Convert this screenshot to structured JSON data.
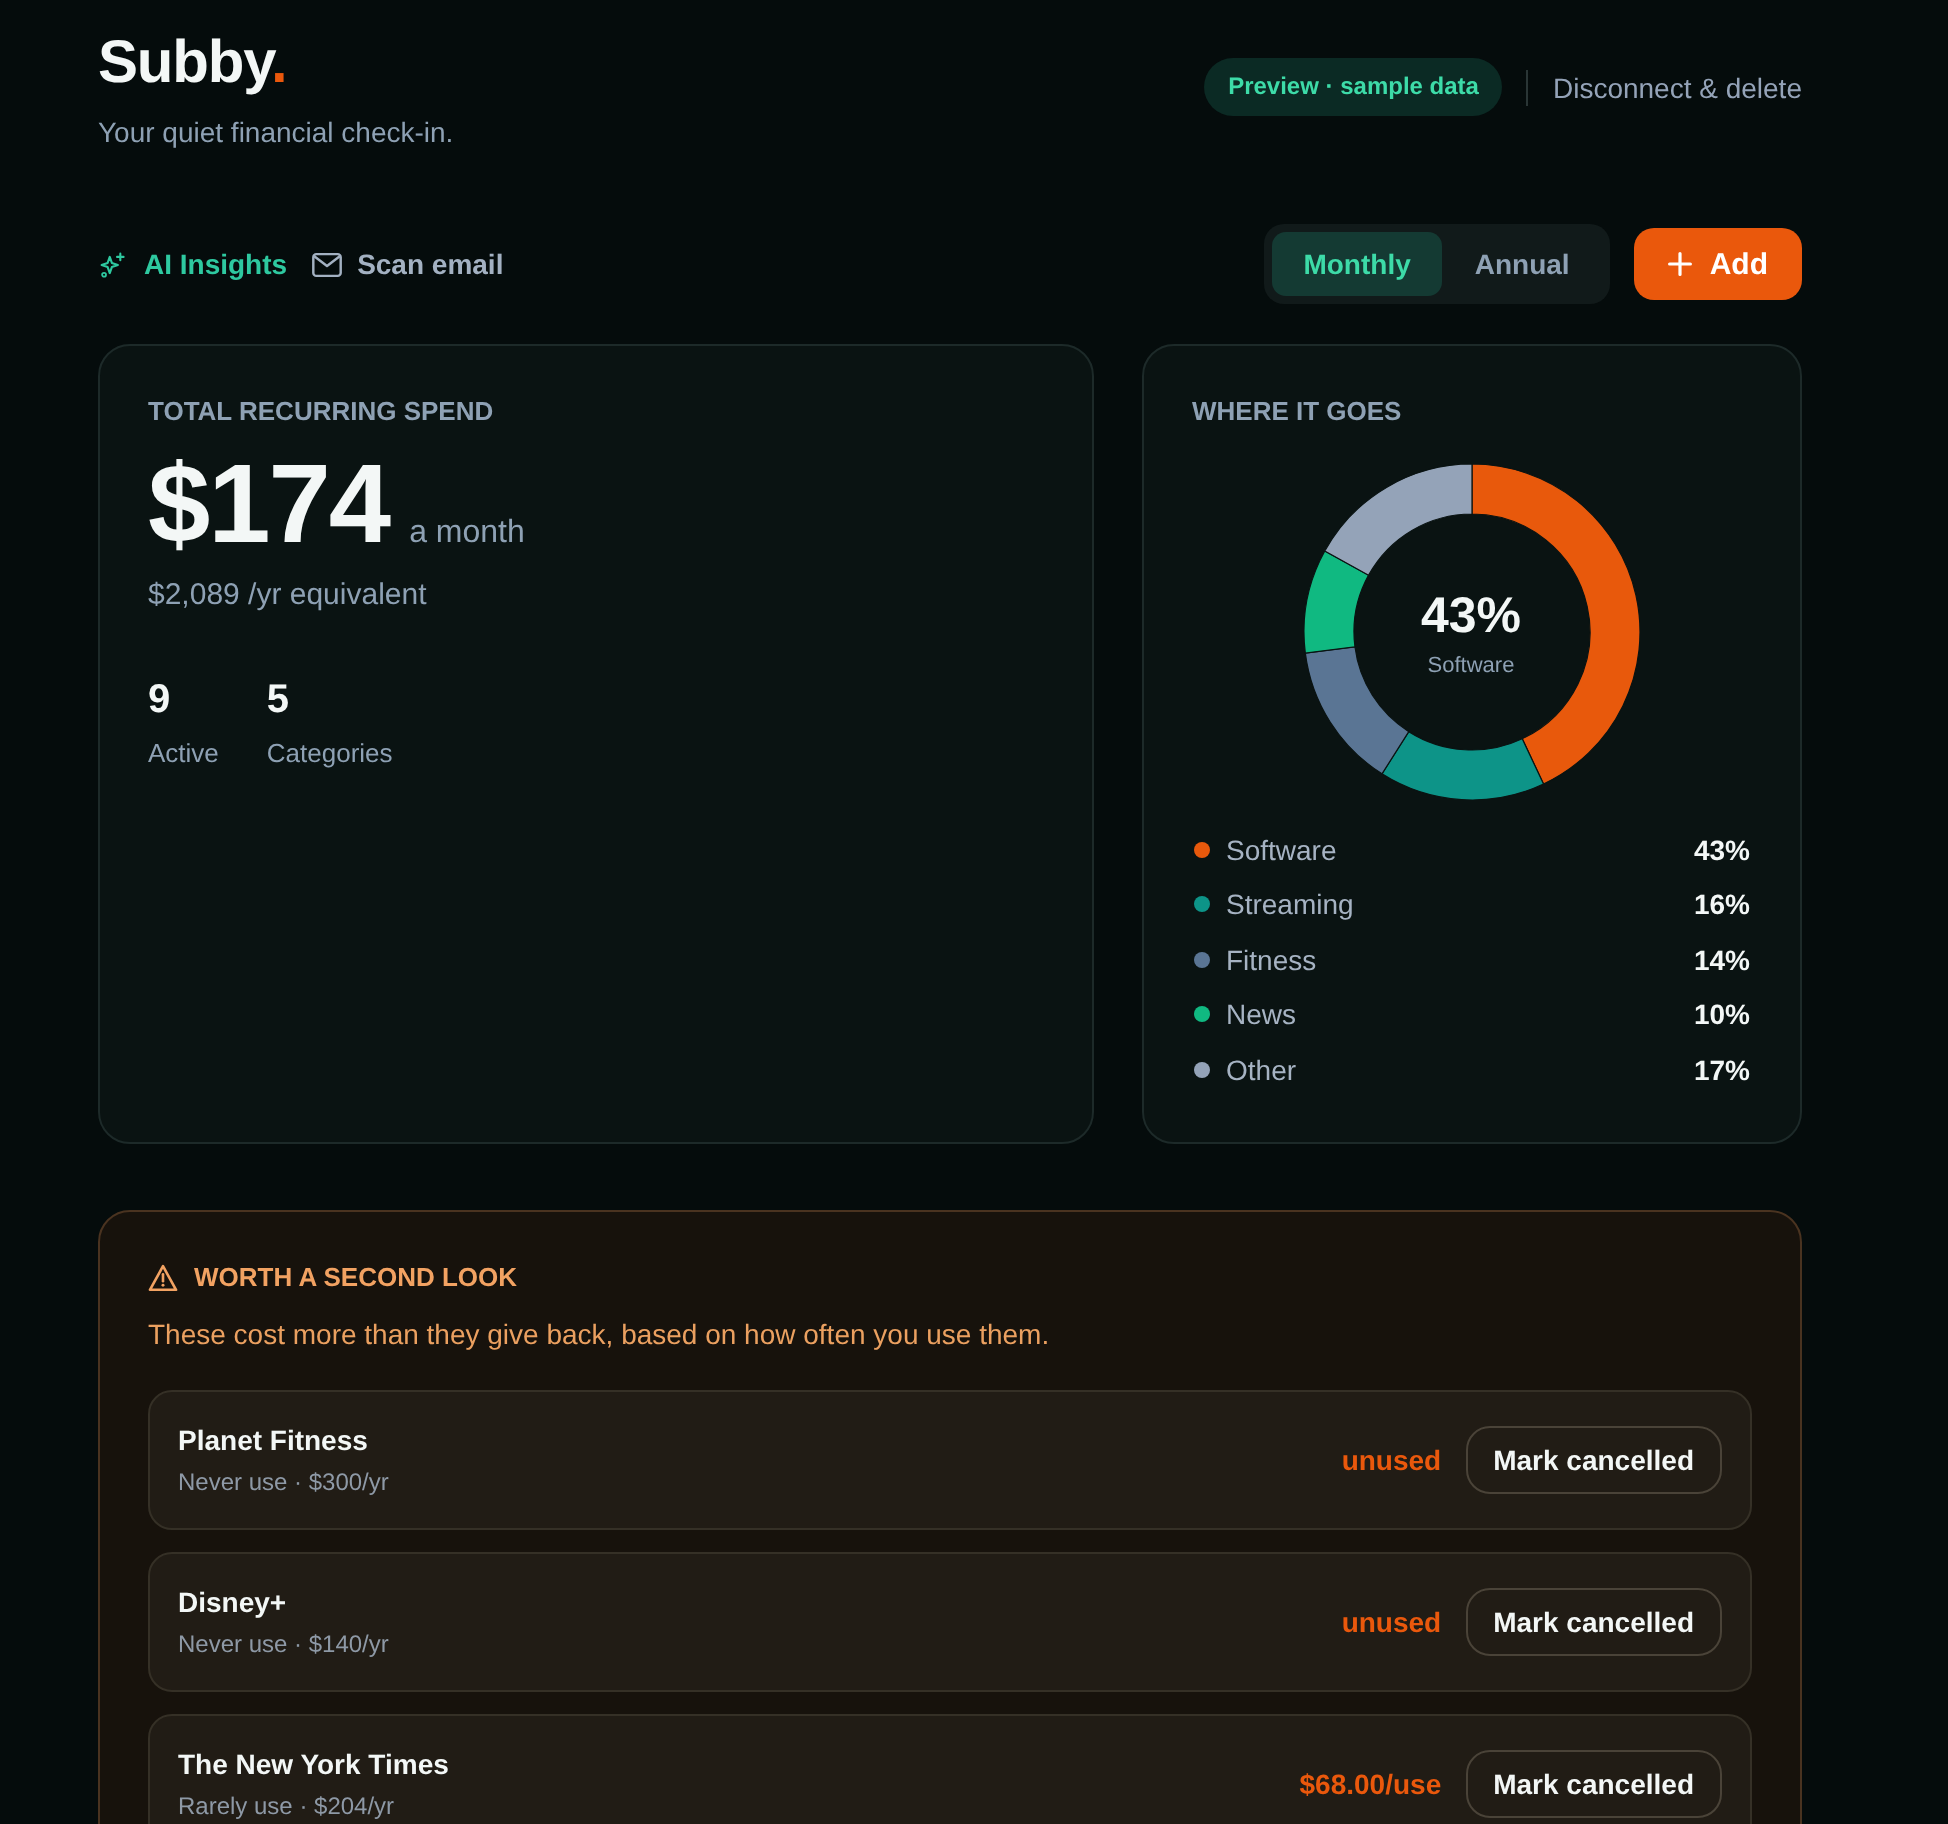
{
  "header": {
    "brand": {
      "name": "Subby",
      "mark": "."
    },
    "tagline": "Your quiet financial check-in.",
    "badge": "Preview · sample data",
    "link": "Disconnect & delete"
  },
  "toolbar": {
    "actions": [
      {
        "kind": "insights",
        "label": "AI Insights"
      },
      {
        "kind": "email",
        "label": "Scan email"
      }
    ],
    "period_toggle": [
      {
        "label": "Monthly",
        "selected": true
      },
      {
        "label": "Annual",
        "selected": false
      }
    ],
    "add_button": {
      "label": "Add"
    }
  },
  "summary": {
    "title": "TOTAL RECURRING SPEND",
    "amount": "$174",
    "period": "a month",
    "yearly": "$2,089 /yr equivalent",
    "stats": [
      {
        "value": "9",
        "label": "Active"
      },
      {
        "value": "5",
        "label": "Categories"
      }
    ]
  },
  "breakdown": {
    "title": "WHERE IT GOES",
    "center": {
      "value": "43%",
      "label": "Software"
    },
    "chart_data": {
      "type": "donut",
      "values": [
        43,
        16,
        14,
        10,
        17
      ]
    },
    "legend": [
      {
        "label": "Software",
        "share": "43%",
        "color": "#e8590c"
      },
      {
        "label": "Streaming",
        "share": "16%",
        "color": "#0d9488"
      },
      {
        "label": "Fitness",
        "share": "14%",
        "color": "#5a7594"
      },
      {
        "label": "News",
        "share": "10%",
        "color": "#10b981"
      },
      {
        "label": "Other",
        "share": "17%",
        "color": "#94a3b8"
      }
    ]
  },
  "review": {
    "title": "WORTH A SECOND LOOK",
    "note": "These cost more than they give back, based on how often you use them.",
    "items": [
      {
        "name": "Planet Fitness",
        "detail": "Never use · $300/yr",
        "flag": "unused",
        "action": "Mark cancelled"
      },
      {
        "name": "Disney+",
        "detail": "Never use · $140/yr",
        "flag": "unused",
        "action": "Mark cancelled"
      },
      {
        "name": "The New York Times",
        "detail": "Rarely use · $204/yr",
        "flag": "$68.00/use",
        "action": "Mark cancelled"
      }
    ]
  }
}
